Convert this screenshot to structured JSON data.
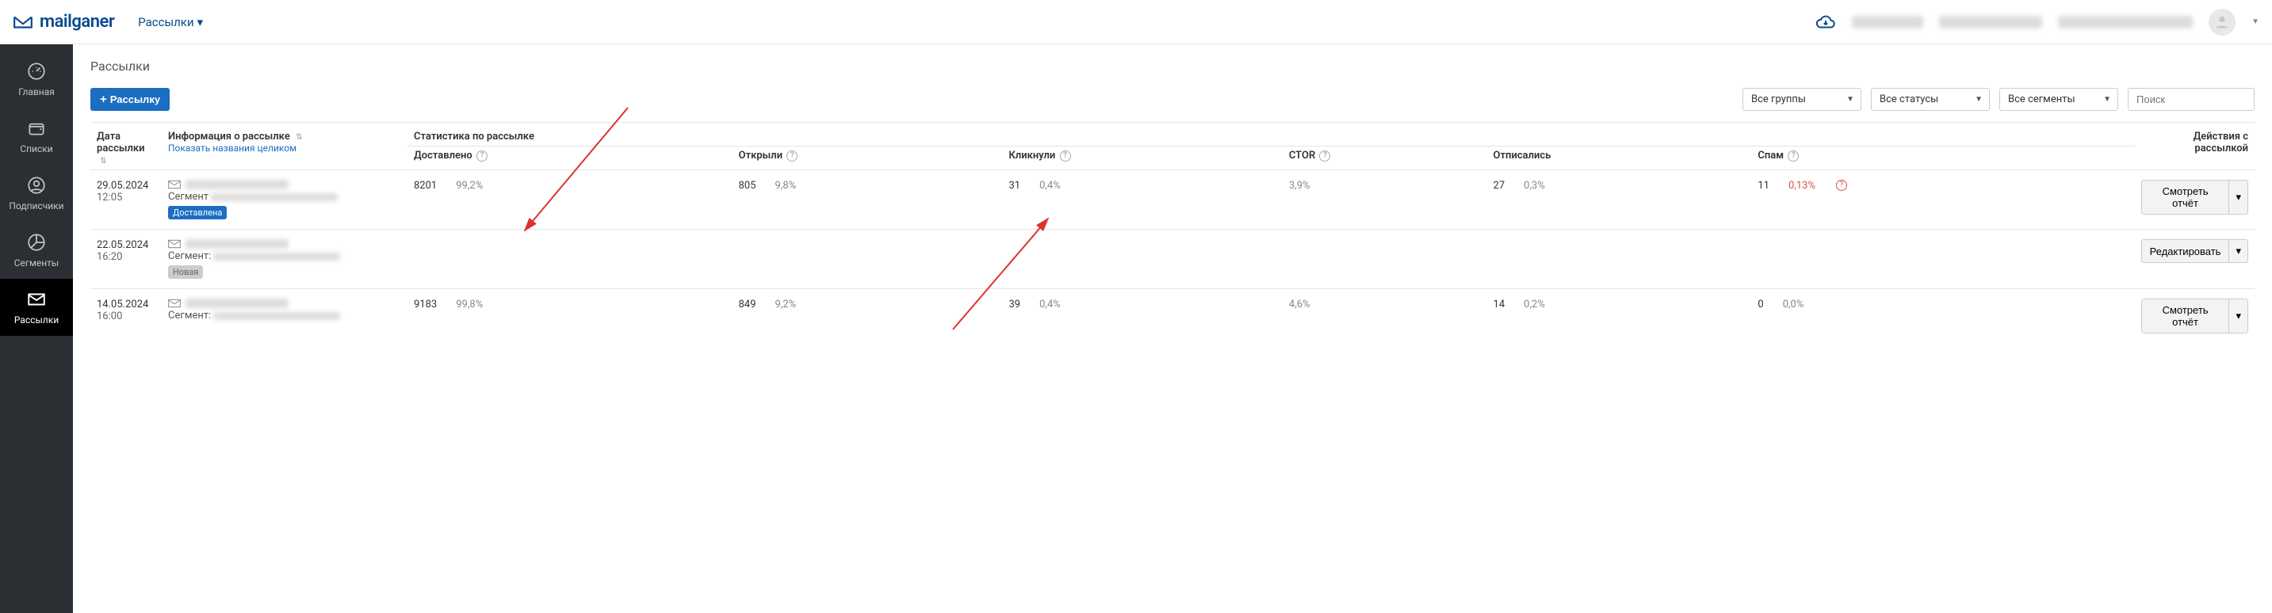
{
  "header": {
    "logo_text": "mailganer",
    "nav_label": "Рассылки"
  },
  "sidebar": {
    "items": [
      {
        "label": "Главная"
      },
      {
        "label": "Списки"
      },
      {
        "label": "Подписчики"
      },
      {
        "label": "Сегменты"
      },
      {
        "label": "Рассылки"
      }
    ]
  },
  "page": {
    "title": "Рассылки"
  },
  "toolbar": {
    "create_label": "Рассылку",
    "group_filter": "Все группы",
    "status_filter": "Все статусы",
    "segment_filter": "Все сегменты",
    "search_placeholder": "Поиск"
  },
  "table": {
    "col_date": "Дата рассылки",
    "col_info": "Информация о рассылке",
    "show_full_link": "Показать названия целиком",
    "col_stats": "Статистика по рассылке",
    "col_delivered": "Доставлено",
    "col_opened": "Открыли",
    "col_clicked": "Кликнули",
    "col_ctor": "CTOR",
    "col_unsub": "Отписались",
    "col_spam": "Спам",
    "col_actions": "Действия с рассылкой"
  },
  "rows": [
    {
      "date": "29.05.2024",
      "time": "12:05",
      "segment_label": "Сегмент",
      "status_badge": "Доставлена",
      "badge_class": "delivered",
      "delivered_n": "8201",
      "delivered_pct": "99,2%",
      "opened_n": "805",
      "opened_pct": "9,8%",
      "clicked_n": "31",
      "clicked_pct": "0,4%",
      "ctor": "3,9%",
      "unsub_n": "27",
      "unsub_pct": "0,3%",
      "spam_n": "11",
      "spam_pct": "0,13%",
      "spam_alert": true,
      "action": "Смотреть отчёт"
    },
    {
      "date": "22.05.2024",
      "time": "16:20",
      "segment_label": "Сегмент:",
      "status_badge": "Новая",
      "badge_class": "new",
      "delivered_n": "",
      "delivered_pct": "",
      "opened_n": "",
      "opened_pct": "",
      "clicked_n": "",
      "clicked_pct": "",
      "ctor": "",
      "unsub_n": "",
      "unsub_pct": "",
      "spam_n": "",
      "spam_pct": "",
      "spam_alert": false,
      "action": "Редактировать"
    },
    {
      "date": "14.05.2024",
      "time": "16:00",
      "segment_label": "Сегмент:",
      "status_badge": "",
      "badge_class": "",
      "delivered_n": "9183",
      "delivered_pct": "99,8%",
      "opened_n": "849",
      "opened_pct": "9,2%",
      "clicked_n": "39",
      "clicked_pct": "0,4%",
      "ctor": "4,6%",
      "unsub_n": "14",
      "unsub_pct": "0,2%",
      "spam_n": "0",
      "spam_pct": "0,0%",
      "spam_alert": false,
      "action": "Смотреть отчёт"
    }
  ]
}
